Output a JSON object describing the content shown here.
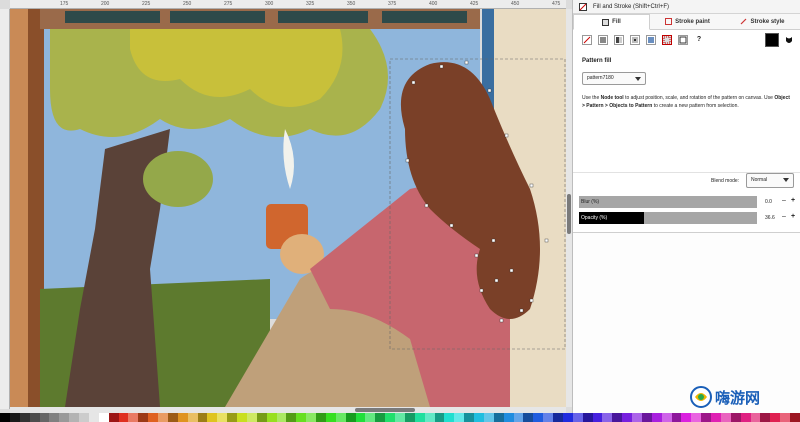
{
  "ruler": {
    "ticks": [
      "175",
      "200",
      "225",
      "250",
      "275",
      "300",
      "325",
      "350",
      "375",
      "400",
      "425",
      "450",
      "475"
    ]
  },
  "dialog": {
    "title": "Fill and Stroke (Shift+Ctrl+F)",
    "tabs": [
      {
        "label": "Fill",
        "icon": "fill-icon"
      },
      {
        "label": "Stroke paint",
        "icon": "stroke-paint-icon"
      },
      {
        "label": "Stroke style",
        "icon": "stroke-style-icon"
      }
    ],
    "fill_modes": [
      "no-paint",
      "flat-color",
      "linear-gradient",
      "radial-gradient",
      "mesh-gradient",
      "pattern",
      "swatch",
      "unset"
    ],
    "pattern_label": "Pattern fill",
    "pattern_value": "pattern7180",
    "help": {
      "p1": "Use the ",
      "b1": "Node tool",
      "p2": " to adjust position, scale, and rotation of the pattern on canvas. Use ",
      "b2": "Object > Pattern > Objects to Pattern",
      "p3": " to create a new pattern from selection."
    },
    "blend_label": "Blend mode:",
    "blend_value": "Normal",
    "blur": {
      "label": "Blur (%)",
      "value": "0.0",
      "fraction": 0.0
    },
    "opacity": {
      "label": "Opacity (%)",
      "value": "36.6",
      "fraction": 0.366
    }
  },
  "watermark": {
    "text": "嗨游网"
  },
  "colors": {
    "accent": "#1a5fb8",
    "slider_bg": "#a6a6a6",
    "pattern_active": "#c00000"
  }
}
